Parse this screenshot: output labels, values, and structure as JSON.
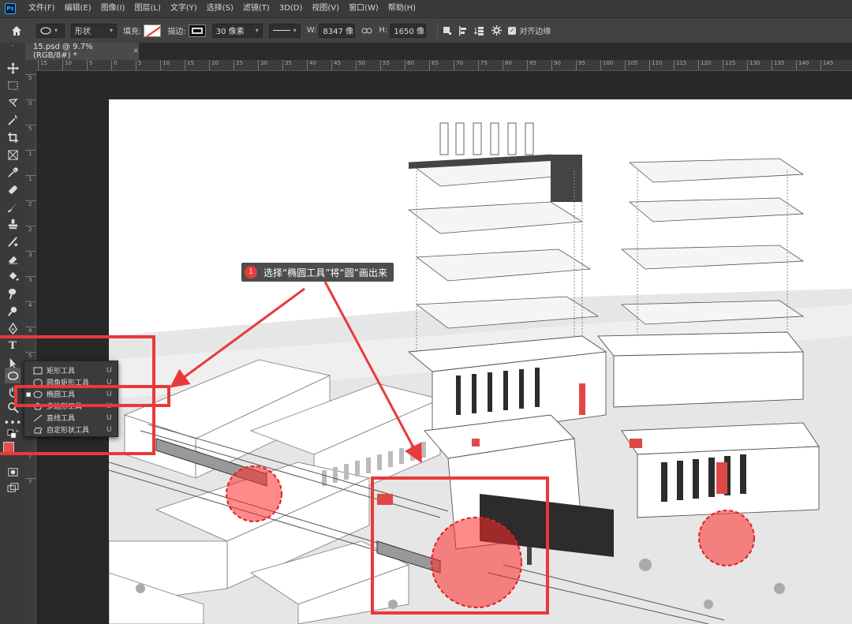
{
  "app": {
    "logo": "Ps"
  },
  "menu": [
    "文件(F)",
    "编辑(E)",
    "图像(I)",
    "图层(L)",
    "文字(Y)",
    "选择(S)",
    "滤镜(T)",
    "3D(D)",
    "视图(V)",
    "窗口(W)",
    "帮助(H)"
  ],
  "options": {
    "mode": "形状",
    "fill_label": "填充:",
    "stroke_label": "描边:",
    "stroke_width": "30 像素",
    "w_label": "W:",
    "w_value": "8347 像",
    "link_icon": "link-icon",
    "h_label": "H:",
    "h_value": "1650 像",
    "align_edges": "对齐边缘",
    "colors": {
      "fill_slash": "#e03030"
    }
  },
  "document_tab": {
    "title": "15.psd @ 9.7%(RGB/8#) *",
    "close": "×"
  },
  "ruler": {
    "h_labels": [
      "15",
      "10",
      "5",
      "0",
      "5",
      "10",
      "15",
      "20",
      "25",
      "30",
      "35",
      "40",
      "45",
      "50",
      "55",
      "60",
      "65",
      "70",
      "75",
      "80",
      "85",
      "90",
      "95",
      "100",
      "105",
      "110",
      "115",
      "120",
      "125",
      "130",
      "135",
      "140",
      "145"
    ],
    "v_labels": [
      "5",
      "0",
      "5",
      "1",
      "1",
      "2",
      "2",
      "3",
      "3",
      "4",
      "4",
      "5",
      "5",
      "6",
      "6",
      "7",
      "7"
    ]
  },
  "flyout": {
    "items": [
      {
        "label": "矩形工具",
        "key": "U",
        "icon": "rectangle-icon",
        "selected": false
      },
      {
        "label": "圆角矩形工具",
        "key": "U",
        "icon": "rounded-rectangle-icon",
        "selected": false
      },
      {
        "label": "椭圆工具",
        "key": "U",
        "icon": "ellipse-icon",
        "selected": true
      },
      {
        "label": "多边形工具",
        "key": "U",
        "icon": "polygon-icon",
        "selected": false
      },
      {
        "label": "直线工具",
        "key": "U",
        "icon": "line-icon",
        "selected": false
      },
      {
        "label": "自定形状工具",
        "key": "U",
        "icon": "custom-shape-icon",
        "selected": false
      }
    ]
  },
  "callout": {
    "number": "1",
    "text": "选择“椭圆工具”将“圆”画出来"
  },
  "colors": {
    "highlight": "#e8393b",
    "foreground": "#e05050",
    "background": "#ffffff"
  }
}
